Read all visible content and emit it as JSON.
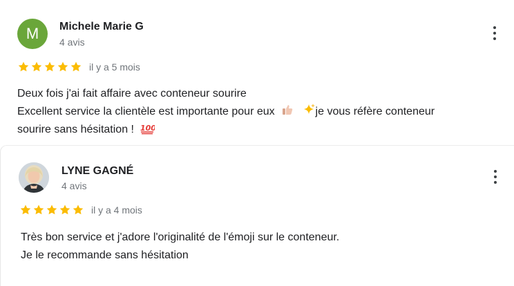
{
  "reviews": [
    {
      "avatar_letter": "M",
      "avatar_color": "#6aa63a",
      "name": "Michele Marie G",
      "review_count": "4 avis",
      "rating": 5,
      "time": "il y a 5 mois",
      "text": {
        "line1": "Deux fois j'ai fait affaire avec conteneur sourire",
        "line2_a": "Excellent service la clientèle est importante pour eux",
        "line2_b": "je vous réfère conteneur",
        "line3": "sourire sans hésitation !"
      },
      "emoji": [
        "thumbs-up-icon",
        "sparkles-icon",
        "hundred-points-icon"
      ]
    },
    {
      "avatar_image": "profile-photo",
      "name": "LYNE GAGNÉ",
      "review_count": "4 avis",
      "rating": 5,
      "time": "il y a 4 mois",
      "text": {
        "line1": "Très bon service et j'adore l'originalité de l'émoji sur le conteneur.",
        "line2": "Je le recommande sans hésitation"
      }
    }
  ],
  "colors": {
    "star": "#fbbc04",
    "secondary_text": "#70757a",
    "primary_text": "#202124"
  }
}
